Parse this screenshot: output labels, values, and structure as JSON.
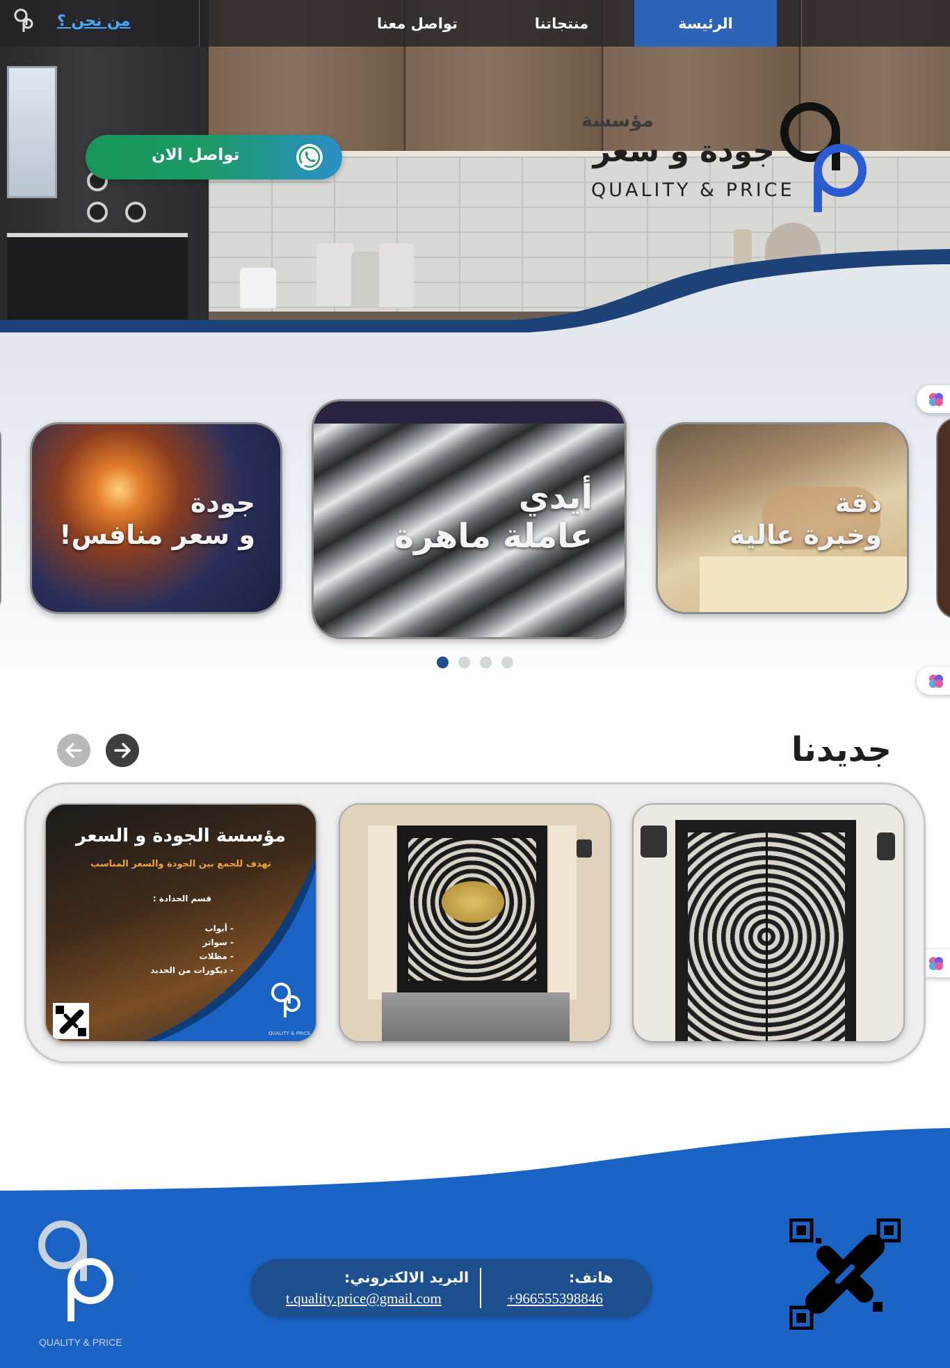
{
  "nav": {
    "items": [
      {
        "label": "الرئيسة",
        "active": true
      },
      {
        "label": "منتجاتنا",
        "active": false
      },
      {
        "label": "تواصل معنا",
        "active": false
      }
    ],
    "about_link": "من نحن ؟"
  },
  "brand": {
    "prefix": "مؤسسة",
    "name": "جودة و سعر",
    "english": "QUALITY & PRICE"
  },
  "cta": {
    "label": "تواصل الان",
    "icon": "whatsapp-icon"
  },
  "slider": {
    "slides": [
      {
        "line1": "دقة",
        "line2": "وخبرة عالية"
      },
      {
        "line1": "أيدي",
        "line2": "عاملة ماهرة"
      },
      {
        "line1": "جودة",
        "line2": "و سعر منافس!"
      }
    ],
    "dots_count": 4,
    "active_dot": 0
  },
  "new_section": {
    "title": "جديدنا",
    "flyer": {
      "title": "مؤسسة الجودة و السعر",
      "subtitle": "تهدف للجمع بين الجودة والسعر المناسب",
      "dept": "قسم الحدادة :",
      "items": [
        "- أبواب",
        "- سواتر",
        "- مظلات",
        "- ديكورات من الحديد"
      ],
      "logo_text": "QUALITY & PRICE"
    }
  },
  "footer": {
    "phone_label": "هاتف:",
    "phone_value": "+966555398846",
    "email_label": "البريد الالكتروني:",
    "email_value": "t.quality.price@gmail.com",
    "logo_text": "QUALITY & PRICE"
  },
  "colors": {
    "accent": "#2d64b8",
    "footer_blue": "#1a63c4",
    "dark_navy": "#1f4f8f",
    "whatsapp_green": "#17965a"
  }
}
